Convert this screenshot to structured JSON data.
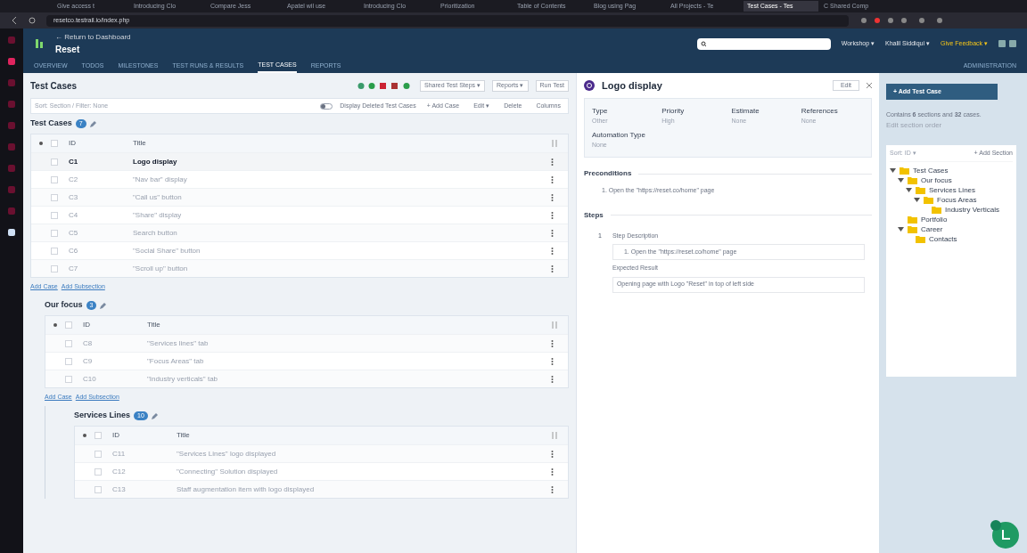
{
  "browser": {
    "tabs": [
      {
        "title": "Give access t",
        "selected": false
      },
      {
        "title": "Introducing Clo",
        "selected": false
      },
      {
        "title": "Compare Jess",
        "selected": false
      },
      {
        "title": "Apatel wil use",
        "selected": false
      },
      {
        "title": "Introducing Clo",
        "selected": false
      },
      {
        "title": "Prioritization",
        "selected": false
      },
      {
        "title": "Table of Contents",
        "selected": false
      },
      {
        "title": "Blog using Pag",
        "selected": false
      },
      {
        "title": "All Projects - Te",
        "selected": false
      },
      {
        "title": "Test Cases - Tes",
        "selected": true
      },
      {
        "title": "C Shared Comp",
        "selected": false
      }
    ],
    "address": "resetco.testrail.io/index.php"
  },
  "header": {
    "back_link": "← Return to Dashboard",
    "project": "Reset",
    "menus": [
      "Workshop ▾",
      "Khalil Siddiqui ▾",
      "Give Feedback ▾"
    ]
  },
  "nav": {
    "tabs": [
      {
        "label": "OVERVIEW",
        "selected": false
      },
      {
        "label": "TODOS",
        "selected": false
      },
      {
        "label": "MILESTONES",
        "selected": false
      },
      {
        "label": "TEST RUNS & RESULTS",
        "selected": false
      },
      {
        "label": "TEST CASES",
        "selected": true
      },
      {
        "label": "REPORTS",
        "selected": false
      }
    ],
    "admin": "ADMINISTRATION"
  },
  "cases_panel": {
    "title": "Test Cases",
    "toolbar": [
      "Shared Test Steps ▾",
      "Reports ▾",
      "Run Test"
    ],
    "sort_filter": "Sort: Section / Filter: None",
    "deleted_toggle": {
      "label": "Display Deleted Test Cases",
      "on": false
    },
    "actions": [
      "+ Add Case",
      "Edit ▾",
      "Delete",
      "Columns"
    ],
    "sections": [
      {
        "name": "Test Cases",
        "count": "7",
        "all_checked": false,
        "columns": [
          "ID",
          "Title"
        ],
        "links": [
          "Add Case",
          "Add Subsection"
        ],
        "rows": [
          {
            "id": "C1",
            "title": "Logo display",
            "selected": true,
            "checked": false
          },
          {
            "id": "C2",
            "title": "\"Nav bar\" display",
            "selected": false,
            "checked": false
          },
          {
            "id": "C3",
            "title": "\"Call us\" button",
            "selected": false,
            "checked": false
          },
          {
            "id": "C4",
            "title": "\"Share\" display",
            "selected": false,
            "checked": false
          },
          {
            "id": "C5",
            "title": "Search button",
            "selected": false,
            "checked": false
          },
          {
            "id": "C6",
            "title": "\"Social Share\" button",
            "selected": false,
            "checked": false
          },
          {
            "id": "C7",
            "title": "\"Scroll up\" button",
            "selected": false,
            "checked": false
          }
        ]
      },
      {
        "name": "Our focus",
        "count": "3",
        "all_checked": false,
        "columns": [
          "ID",
          "Title"
        ],
        "links": [
          "Add Case",
          "Add Subsection"
        ],
        "rows": [
          {
            "id": "C8",
            "title": "\"Services lines\" tab",
            "selected": false,
            "checked": false
          },
          {
            "id": "C9",
            "title": "\"Focus Areas\" tab",
            "selected": false,
            "checked": false
          },
          {
            "id": "C10",
            "title": "\"Industry verticals\" tab",
            "selected": false,
            "checked": false
          }
        ]
      },
      {
        "name": "Services Lines",
        "count": "10",
        "all_checked": false,
        "columns": [
          "ID",
          "Title"
        ],
        "rows": [
          {
            "id": "C11",
            "title": "\"Services Lines\" logo displayed",
            "selected": false,
            "checked": false
          },
          {
            "id": "C12",
            "title": "\"Connecting\" Solution displayed",
            "selected": false,
            "checked": false
          },
          {
            "id": "C13",
            "title": "Staff augmentation item with logo displayed",
            "selected": false,
            "checked": false
          }
        ]
      }
    ]
  },
  "detail": {
    "title": "Logo display",
    "edit": "Edit",
    "fields": [
      {
        "label": "Type",
        "value": "Other"
      },
      {
        "label": "Priority",
        "value": "High"
      },
      {
        "label": "Estimate",
        "value": "None"
      },
      {
        "label": "References",
        "value": "None"
      },
      {
        "label": "Automation Type",
        "value": "None"
      }
    ],
    "preconditions_title": "Preconditions",
    "preconditions": "1. Open the \"https://reset.co/home\" page",
    "steps_title": "Steps",
    "steps": [
      {
        "number": "1",
        "description_label": "Step Description",
        "description": "1. Open the \"https://reset.co/home\" page",
        "expected_label": "Expected Result",
        "expected": "Opening page with Logo \"Reset\" in top of left side"
      }
    ]
  },
  "sidebar": {
    "add_button": "+ Add Test Case",
    "summary": "Contains **6** sections and **32** cases.",
    "order_link": "Edit section order",
    "sort": "Sort: ID ▾",
    "add_section": "+ Add Section",
    "tree": [
      {
        "label": "Test Cases",
        "expanded": true,
        "children": [
          {
            "label": "Our focus",
            "expanded": true,
            "children": [
              {
                "label": "Services Lines",
                "expanded": true,
                "children": [
                  {
                    "label": "Focus Areas",
                    "expanded": true,
                    "children": [
                      {
                        "label": "Industry Verticals"
                      }
                    ]
                  }
                ]
              }
            ]
          },
          {
            "label": "Portfolio"
          },
          {
            "label": "Career",
            "expanded": true,
            "children": [
              {
                "label": "Contacts"
              }
            ]
          }
        ]
      }
    ]
  }
}
